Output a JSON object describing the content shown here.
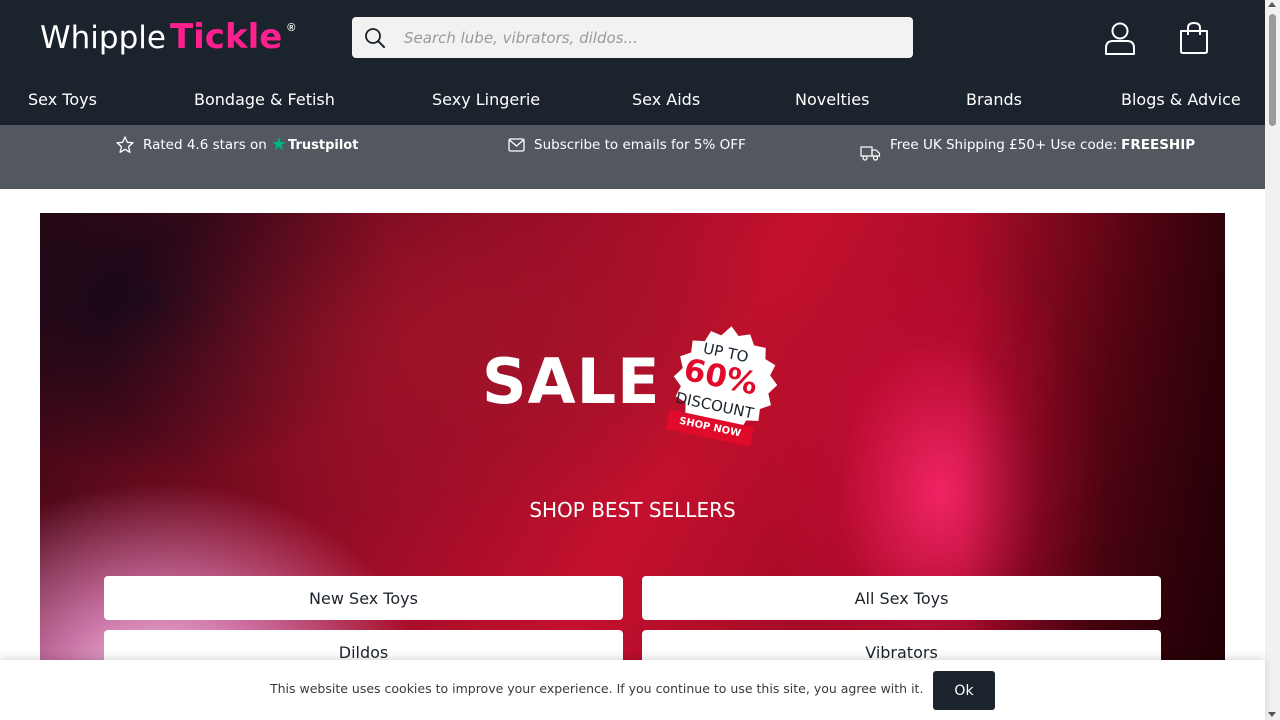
{
  "header": {
    "logo_main": "Whipple",
    "logo_accent": "Tickle",
    "logo_reg": "®",
    "search_placeholder": "Search lube, vibrators, dildos...",
    "icons": {
      "search": "search-icon",
      "account": "user-icon",
      "cart": "shopping-bag-icon"
    }
  },
  "nav": {
    "items": [
      {
        "label": "Sex Toys"
      },
      {
        "label": "Bondage & Fetish"
      },
      {
        "label": "Sexy Lingerie"
      },
      {
        "label": "Sex Aids"
      },
      {
        "label": "Novelties"
      },
      {
        "label": "Brands"
      },
      {
        "label": "Blogs & Advice"
      }
    ]
  },
  "usp": {
    "rating_text": "Rated 4.6 stars on",
    "trustpilot": "Trustpilot",
    "subscribe_text": "Subscribe to emails for 5% OFF",
    "shipping_text": "Free UK Shipping £50+ Use code:",
    "shipping_code": "FREESHIP"
  },
  "hero": {
    "sale": "SALE",
    "badge_upto": "UP TO",
    "badge_pct": "60%",
    "badge_discount": "DISCOUNT",
    "badge_shop": "SHOP NOW",
    "best_sellers": "SHOP BEST SELLERS",
    "categories": [
      {
        "label": "New Sex Toys"
      },
      {
        "label": "All Sex Toys"
      },
      {
        "label": "Dildos"
      },
      {
        "label": "Vibrators"
      }
    ]
  },
  "cookie": {
    "text": "This website uses cookies to improve your experience. If you continue to use this site, you agree with it.",
    "ok": "Ok"
  },
  "colors": {
    "header_bg": "#1b232c",
    "accent_pink": "#ff1f8e",
    "usp_bg": "#535860",
    "sale_red": "#e00b2a",
    "trustpilot_green": "#00b67a"
  }
}
